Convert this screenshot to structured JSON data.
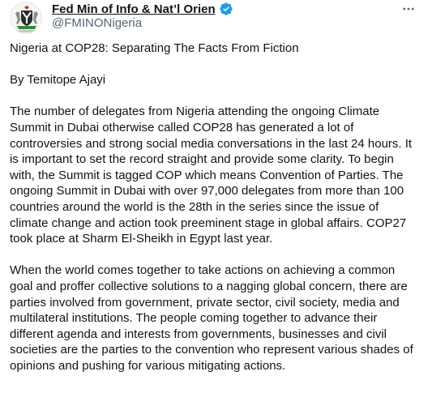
{
  "account": {
    "display_name": "Fed Min of Info & Nat’l Orien",
    "handle": "@FMINONigeria",
    "verified_icon": "verified-badge-icon",
    "verified_color": "#1d9bf0",
    "avatar_icon": "coat-of-arms-icon",
    "more_icon": "more-options-icon"
  },
  "post": {
    "title": "Nigeria at COP28: Separating The Facts From Fiction",
    "byline": "By Temitope Ajayi",
    "paragraph_1": "The number of delegates from Nigeria attending the ongoing Climate Summit in Dubai otherwise called COP28 has generated a lot of controversies and strong social media conversations in the last 24 hours. It is important to set the record straight and provide some clarity. To begin with, the Summit is tagged COP which means Convention of Parties. The ongoing Summit in Dubai with over 97,000 delegates from more than 100 countries around the world is the 28th in the series since the issue of climate change and action took preeminent stage in global affairs. COP27 took place at Sharm El-Sheikh in Egypt last year.",
    "paragraph_2": "When the world comes together to take actions on achieving a common goal and proffer collective solutions to a nagging global concern, there are parties involved from government, private sector, civil society, media and multilateral institutions. The people coming together to advance their different agenda and interests from governments, businesses and civil societies are the parties to the convention who represent various shades of opinions and pushing for various mitigating actions."
  },
  "colors": {
    "text": "#0f1419",
    "secondary": "#536471",
    "accent": "#1d9bf0"
  }
}
